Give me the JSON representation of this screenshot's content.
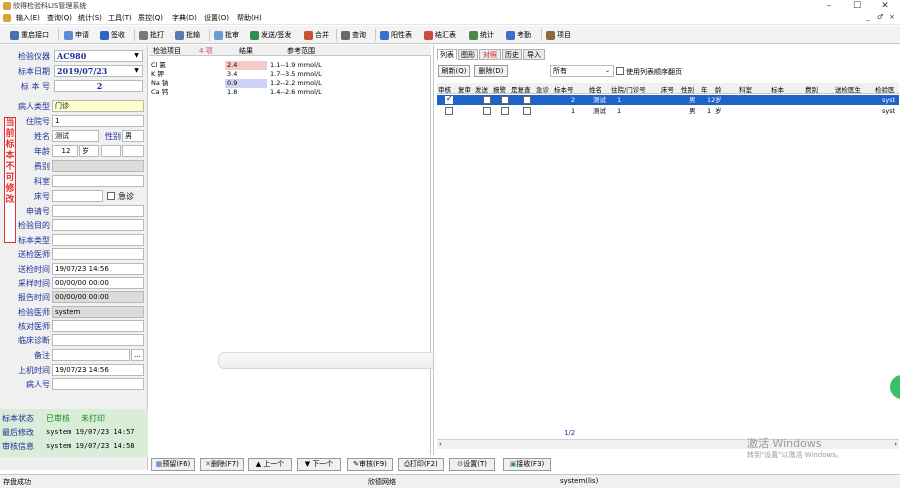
{
  "window": {
    "title": "欣得检验科LIS管理系统",
    "min": "–",
    "max": "☐",
    "close": "✕",
    "mdi_min": "_",
    "mdi_restore": "♂",
    "mdi_close": "×"
  },
  "menu": [
    "输入(E)",
    "查询(Q)",
    "统计(S)",
    "工具(T)",
    "质控(Q)",
    "字典(D)",
    "设置(O)",
    "帮助(H)"
  ],
  "toolbar": [
    {
      "label": "重启接口",
      "icon": "restart-icon",
      "color": "#4a6fb5"
    },
    {
      "label": "申请",
      "icon": "request-icon",
      "color": "#5a8fd6"
    },
    {
      "label": "签收",
      "icon": "sign-icon",
      "color": "#2e64c8"
    },
    {
      "label": "批打",
      "icon": "batch-print-icon",
      "color": "#7a7a7a"
    },
    {
      "label": "批输",
      "icon": "batch-input-icon",
      "color": "#5a7ab8"
    },
    {
      "label": "批审",
      "icon": "batch-review-icon",
      "color": "#6b9ad8"
    },
    {
      "label": "发送/签发",
      "icon": "send-icon",
      "color": "#2f8f4f"
    },
    {
      "label": "合并",
      "icon": "merge-icon",
      "color": "#c8542e"
    },
    {
      "label": "查询",
      "icon": "query-icon",
      "color": "#6a6a6a"
    },
    {
      "label": "阳性表",
      "icon": "positive-table-icon",
      "color": "#3a6ed0"
    },
    {
      "label": "结汇表",
      "icon": "summary-table-icon",
      "color": "#d04a3a"
    },
    {
      "label": "统计",
      "icon": "stats-icon",
      "color": "#4a8a4a"
    },
    {
      "label": "考勤",
      "icon": "attendance-icon",
      "color": "#3a6ed0"
    },
    {
      "label": "项目",
      "icon": "project-icon",
      "color": "#8a6a3a"
    }
  ],
  "left": {
    "instrument_label": "检验仪器",
    "instrument_value": "AC980",
    "date_label": "标本日期",
    "date_value": "2019/07/23",
    "sample_no_label": "标 本 号",
    "sample_no_value": "2",
    "patient_type_label": "病人类型",
    "patient_type_value": "门诊",
    "warning_tag": "当前标本不可修改",
    "fields": [
      {
        "label": "住院号",
        "value": "1",
        "style": "white"
      },
      {
        "label": "姓名",
        "value": "测试",
        "style": "white"
      },
      {
        "label": "年龄",
        "value": "12",
        "style": "white"
      },
      {
        "label": "费别",
        "value": "",
        "style": "gray"
      },
      {
        "label": "科室",
        "value": "",
        "style": "white"
      },
      {
        "label": "床号",
        "value": "",
        "style": "white"
      },
      {
        "label": "申请号",
        "value": "",
        "style": "white"
      },
      {
        "label": "检验目的",
        "value": "",
        "style": "white"
      },
      {
        "label": "标本类型",
        "value": "",
        "style": "white"
      },
      {
        "label": "送检医师",
        "value": "",
        "style": "white"
      },
      {
        "label": "送检时间",
        "value": "19/07/23 14:56",
        "style": "white"
      },
      {
        "label": "采样时间",
        "value": "00/00/00 00:00",
        "style": "white"
      },
      {
        "label": "报告时间",
        "value": "00/00/00 00:00",
        "style": "gray"
      },
      {
        "label": "检验医师",
        "value": "system",
        "style": "gray"
      },
      {
        "label": "核对医师",
        "value": "",
        "style": "white"
      },
      {
        "label": "临床诊断",
        "value": "",
        "style": "white"
      },
      {
        "label": "备注",
        "value": "",
        "style": "white"
      },
      {
        "label": "上机时间",
        "value": "19/07/23 14:56",
        "style": "white"
      },
      {
        "label": "病人号",
        "value": "",
        "style": "white"
      }
    ],
    "gender_label": "性别",
    "gender_value": "男",
    "age_unit": "岁",
    "urgent_label": "急诊",
    "ellipsis": "...",
    "status": {
      "state_label": "标本状态",
      "state_value_1": "已审核",
      "state_value_2": "未打印",
      "last_modified_label": "最后修改",
      "last_modified_value": "system  19/07/23 14:57",
      "review_label": "审核信息",
      "review_value": "system  19/07/23 14:58"
    }
  },
  "center": {
    "headers": {
      "item": "检验项目",
      "count": "4 项",
      "result": "结果",
      "ref": "参考范围"
    },
    "rows": [
      {
        "name": "Cl 氯",
        "result": "2.4",
        "ref": "1.1--1.9 mmol/L",
        "flag_color": "#f6c9c9"
      },
      {
        "name": "K 钾",
        "result": "3.4",
        "ref": "1.7--3.5 mmol/L",
        "flag_color": "#ffffff"
      },
      {
        "name": "Na 钠",
        "result": "0.9",
        "ref": "1.2--2.2 mmol/L",
        "flag_color": "#cfd0f5"
      },
      {
        "name": "Ca 钙",
        "result": "1.8",
        "ref": "1.4--2.6 mmol/L",
        "flag_color": "#ffffff"
      }
    ]
  },
  "bottom_buttons": [
    "预留(F6)",
    "删除(F7)",
    "上一个",
    "下一个",
    "审核(F9)",
    "打印(F2)",
    "设置(T)",
    "接收(F3)"
  ],
  "right": {
    "tabs": [
      "列表",
      "图形",
      "对照",
      "历史",
      "导入"
    ],
    "refresh": "刷新(Q)",
    "delete": "删除(D)",
    "filter_value": "所有",
    "use_sort_label": "使用列表顺序翻页",
    "list_headers": [
      "审核",
      "复审",
      "发送",
      "报警",
      "是复查",
      "急诊",
      "标本号",
      "姓名",
      "住院/门诊号",
      "床号",
      "性别",
      "年",
      "龄",
      "科室",
      "标本",
      "费别",
      "送检医生",
      "检验医"
    ],
    "rows": [
      {
        "checked": true,
        "sample_no": "2",
        "name": "测试",
        "inpatient": "1",
        "gender": "男",
        "age": "12",
        "unit": "岁",
        "doctor": "syst",
        "selected": true
      },
      {
        "checked": false,
        "sample_no": "1",
        "name": "测试",
        "inpatient": "1",
        "gender": "男",
        "age": "1",
        "unit": "岁",
        "doctor": "syst",
        "selected": false
      }
    ],
    "page": "1/2",
    "watermark_title": "激活 Windows",
    "watermark_sub": "转到\"设置\"以激活 Windows。"
  },
  "statusbar": {
    "left": "存盘成功",
    "center": "欣德网络",
    "right": "system(lis)"
  }
}
